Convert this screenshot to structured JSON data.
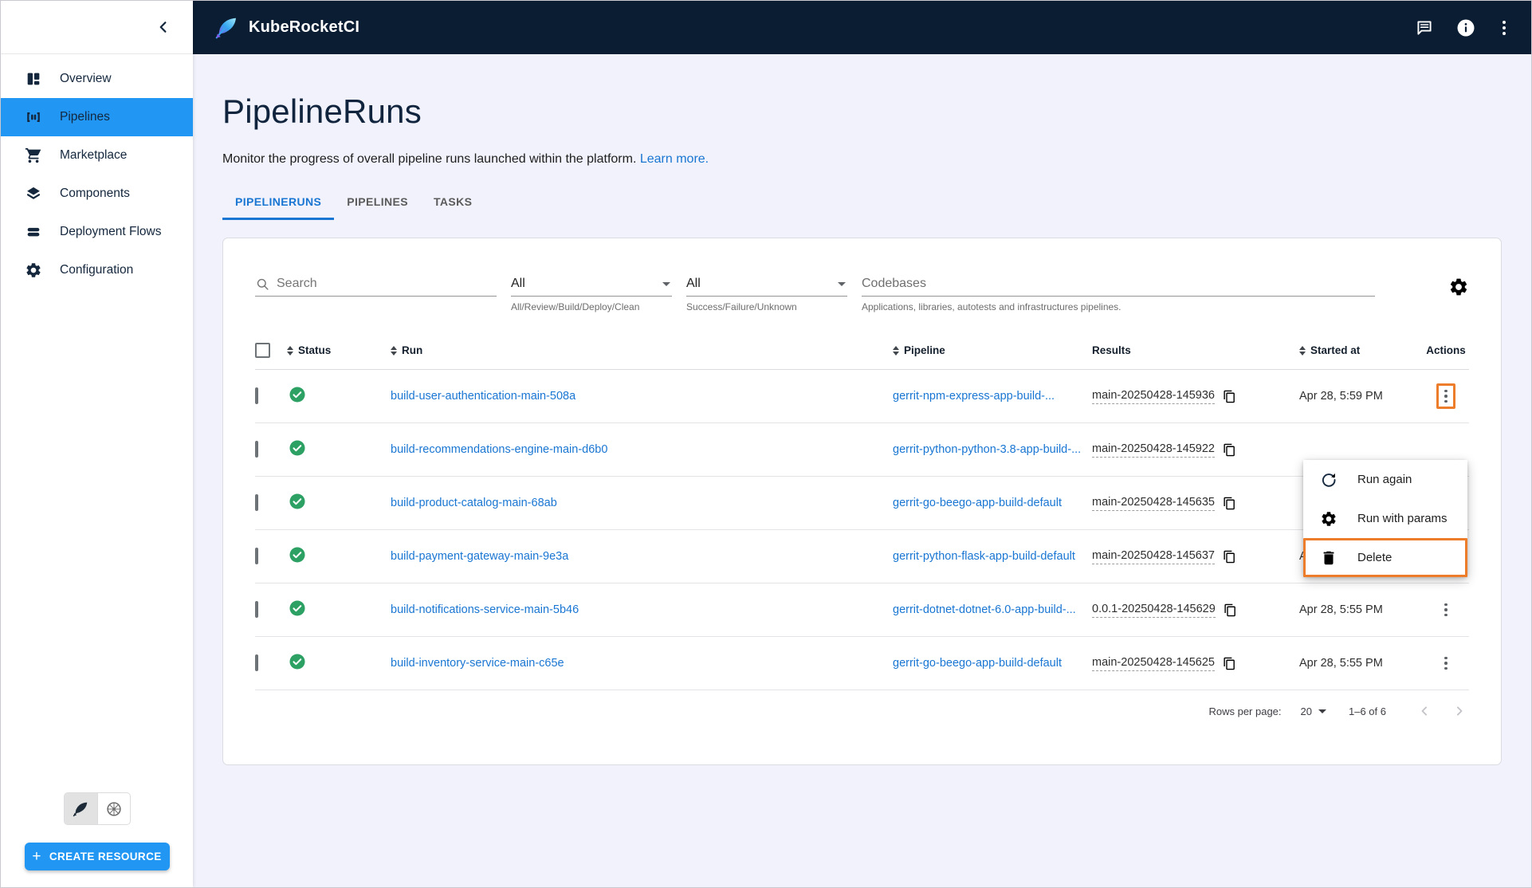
{
  "header": {
    "brand": "KubeRocketCI",
    "action_icons": [
      "feedback-icon",
      "info-icon",
      "kebab-menu-icon"
    ]
  },
  "sidebar": {
    "items": [
      {
        "label": "Overview",
        "icon": "dashboard-icon",
        "active": false
      },
      {
        "label": "Pipelines",
        "icon": "pipelines-icon",
        "active": true
      },
      {
        "label": "Marketplace",
        "icon": "cart-icon",
        "active": false
      },
      {
        "label": "Components",
        "icon": "layers-icon",
        "active": false
      },
      {
        "label": "Deployment Flows",
        "icon": "stack-icon",
        "active": false
      },
      {
        "label": "Configuration",
        "icon": "gear-icon",
        "active": false
      }
    ],
    "view_switcher": [
      {
        "icon": "rocket-feather-icon",
        "selected": true
      },
      {
        "icon": "kubernetes-icon",
        "selected": false
      }
    ],
    "create_button_label": "CREATE RESOURCE"
  },
  "page": {
    "title": "PipelineRuns",
    "description": "Monitor the progress of overall pipeline runs launched within the platform.",
    "learn_more_label": "Learn more.",
    "tabs": [
      {
        "label": "PIPELINERUNS",
        "active": true
      },
      {
        "label": "PIPELINES",
        "active": false
      },
      {
        "label": "TASKS",
        "active": false
      }
    ]
  },
  "filters": {
    "search": {
      "placeholder": "Search"
    },
    "status_select": {
      "value": "All",
      "helper": "All/Review/Build/Deploy/Clean"
    },
    "result_select": {
      "value": "All",
      "helper": "Success/Failure/Unknown"
    },
    "codebases_field": {
      "label": "Codebases",
      "helper": "Applications, libraries, autotests and infrastructures pipelines."
    }
  },
  "table": {
    "headers": {
      "status": "Status",
      "run": "Run",
      "pipeline": "Pipeline",
      "results": "Results",
      "started": "Started at",
      "actions": "Actions"
    },
    "rows": [
      {
        "status": "success",
        "run": "build-user-authentication-main-508a",
        "pipeline": "gerrit-npm-express-app-build-...",
        "result": "main-20250428-145936",
        "started": "Apr 28, 5:59 PM"
      },
      {
        "status": "success",
        "run": "build-recommendations-engine-main-d6b0",
        "pipeline": "gerrit-python-python-3.8-app-build-...",
        "result": "main-20250428-145922",
        "started": ""
      },
      {
        "status": "success",
        "run": "build-product-catalog-main-68ab",
        "pipeline": "gerrit-go-beego-app-build-default",
        "result": "main-20250428-145635",
        "started": ""
      },
      {
        "status": "success",
        "run": "build-payment-gateway-main-9e3a",
        "pipeline": "gerrit-python-flask-app-build-default",
        "result": "main-20250428-145637",
        "started": "Apr 28, 5:55 PM"
      },
      {
        "status": "success",
        "run": "build-notifications-service-main-5b46",
        "pipeline": "gerrit-dotnet-dotnet-6.0-app-build-...",
        "result": "0.0.1-20250428-145629",
        "started": "Apr 28, 5:55 PM"
      },
      {
        "status": "success",
        "run": "build-inventory-service-main-c65e",
        "pipeline": "gerrit-go-beego-app-build-default",
        "result": "main-20250428-145625",
        "started": "Apr 28, 5:55 PM"
      }
    ]
  },
  "context_menu": {
    "items": [
      {
        "label": "Run again",
        "icon": "refresh-icon",
        "highlighted": false
      },
      {
        "label": "Run with params",
        "icon": "gear-run-icon",
        "highlighted": false
      },
      {
        "label": "Delete",
        "icon": "trash-icon",
        "highlighted": true
      }
    ]
  },
  "pagination": {
    "rows_per_page_label": "Rows per page:",
    "rows_per_page_value": "20",
    "range_label": "1–6 of 6"
  },
  "colors": {
    "header_navy": "#0B1D33",
    "accent_blue": "#2196F3",
    "link_blue": "#1976D2",
    "success_green": "#2DA164",
    "annotation_orange": "#ED7D2B",
    "main_background": "#F1F2FB"
  }
}
